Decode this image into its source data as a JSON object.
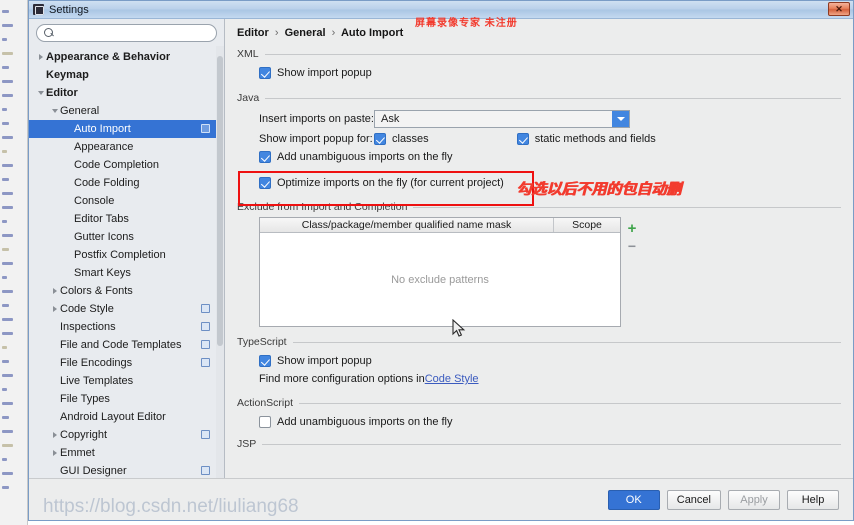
{
  "window": {
    "title": "Settings",
    "icon": "app-icon",
    "close_label": "✕"
  },
  "search": {
    "value": "",
    "placeholder": ""
  },
  "sidebar": {
    "items": [
      {
        "label": "Appearance & Behavior",
        "indent": 0,
        "twisty": "right",
        "bold": true,
        "selected": false,
        "icon": false
      },
      {
        "label": "Keymap",
        "indent": 0,
        "twisty": "none",
        "bold": true,
        "selected": false,
        "icon": false
      },
      {
        "label": "Editor",
        "indent": 0,
        "twisty": "down",
        "bold": true,
        "selected": false,
        "icon": false
      },
      {
        "label": "General",
        "indent": 1,
        "twisty": "down",
        "bold": false,
        "selected": false,
        "icon": false
      },
      {
        "label": "Auto Import",
        "indent": 2,
        "twisty": "none",
        "bold": false,
        "selected": true,
        "icon": true
      },
      {
        "label": "Appearance",
        "indent": 2,
        "twisty": "none",
        "bold": false,
        "selected": false,
        "icon": false
      },
      {
        "label": "Code Completion",
        "indent": 2,
        "twisty": "none",
        "bold": false,
        "selected": false,
        "icon": false
      },
      {
        "label": "Code Folding",
        "indent": 2,
        "twisty": "none",
        "bold": false,
        "selected": false,
        "icon": false
      },
      {
        "label": "Console",
        "indent": 2,
        "twisty": "none",
        "bold": false,
        "selected": false,
        "icon": false
      },
      {
        "label": "Editor Tabs",
        "indent": 2,
        "twisty": "none",
        "bold": false,
        "selected": false,
        "icon": false
      },
      {
        "label": "Gutter Icons",
        "indent": 2,
        "twisty": "none",
        "bold": false,
        "selected": false,
        "icon": false
      },
      {
        "label": "Postfix Completion",
        "indent": 2,
        "twisty": "none",
        "bold": false,
        "selected": false,
        "icon": false
      },
      {
        "label": "Smart Keys",
        "indent": 2,
        "twisty": "none",
        "bold": false,
        "selected": false,
        "icon": false
      },
      {
        "label": "Colors & Fonts",
        "indent": 1,
        "twisty": "right",
        "bold": false,
        "selected": false,
        "icon": false
      },
      {
        "label": "Code Style",
        "indent": 1,
        "twisty": "right",
        "bold": false,
        "selected": false,
        "icon": true
      },
      {
        "label": "Inspections",
        "indent": 1,
        "twisty": "none",
        "bold": false,
        "selected": false,
        "icon": true
      },
      {
        "label": "File and Code Templates",
        "indent": 1,
        "twisty": "none",
        "bold": false,
        "selected": false,
        "icon": true
      },
      {
        "label": "File Encodings",
        "indent": 1,
        "twisty": "none",
        "bold": false,
        "selected": false,
        "icon": true
      },
      {
        "label": "Live Templates",
        "indent": 1,
        "twisty": "none",
        "bold": false,
        "selected": false,
        "icon": false
      },
      {
        "label": "File Types",
        "indent": 1,
        "twisty": "none",
        "bold": false,
        "selected": false,
        "icon": false
      },
      {
        "label": "Android Layout Editor",
        "indent": 1,
        "twisty": "none",
        "bold": false,
        "selected": false,
        "icon": false
      },
      {
        "label": "Copyright",
        "indent": 1,
        "twisty": "right",
        "bold": false,
        "selected": false,
        "icon": true
      },
      {
        "label": "Emmet",
        "indent": 1,
        "twisty": "right",
        "bold": false,
        "selected": false,
        "icon": false
      },
      {
        "label": "GUI Designer",
        "indent": 1,
        "twisty": "none",
        "bold": false,
        "selected": false,
        "icon": true
      }
    ]
  },
  "breadcrumb": {
    "part1": "Editor",
    "part2": "General",
    "part3": "Auto Import",
    "sep": "›"
  },
  "sections": {
    "xml": {
      "title": "XML",
      "show_import_popup": "Show import popup",
      "show_import_popup_checked": true
    },
    "java": {
      "title": "Java",
      "insert_imports_label": "Insert imports on paste:",
      "insert_imports_value": "Ask",
      "show_popup_for_label": "Show import popup for:",
      "classes_label": "classes",
      "classes_checked": true,
      "static_label": "static methods and fields",
      "static_checked": true,
      "add_unambiguous_label": "Add unambiguous imports on the fly",
      "add_unambiguous_checked": true,
      "optimize_label": "Optimize imports on the fly (for current project)",
      "optimize_checked": true,
      "exclude_title": "Exclude from Import and Completion",
      "table": {
        "columns": [
          "Class/package/member qualified name mask",
          "Scope"
        ],
        "rows": [],
        "empty_text": "No exclude patterns",
        "add_button": "+",
        "remove_button": "−"
      }
    },
    "typescript": {
      "title": "TypeScript",
      "show_import_popup": "Show import popup",
      "show_import_popup_checked": true,
      "hint_prefix": "Find more configuration options in ",
      "hint_link": "Code Style"
    },
    "actionscript": {
      "title": "ActionScript",
      "add_unambiguous_label": "Add unambiguous imports on the fly",
      "add_unambiguous_checked": false
    },
    "jsp": {
      "title": "JSP"
    }
  },
  "annotations": {
    "top_watermark": "屏幕录像专家  未注册",
    "red_note": "勾选以后不用的包自动删",
    "csdn_watermark": "https://blog.csdn.net/liuliang68"
  },
  "footer": {
    "ok": "OK",
    "cancel": "Cancel",
    "apply": "Apply",
    "help": "Help"
  },
  "colors": {
    "accent": "#3573d4",
    "checkbox": "#4286e0",
    "annotation_red": "#f23b2e",
    "link": "#3b5bbf"
  }
}
